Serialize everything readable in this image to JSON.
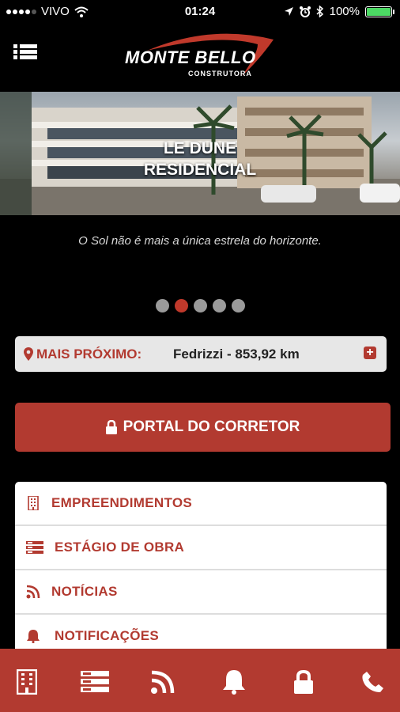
{
  "status_bar": {
    "carrier": "VIVO",
    "time": "01:24",
    "battery": "100%",
    "battery_level": 1.0
  },
  "header": {
    "logo_name": "MONTE BELLO",
    "logo_sub": "CONSTRUTORA"
  },
  "hero": {
    "title_line1": "LE DUNE",
    "title_line2": "RESIDENCIAL",
    "tagline": "O Sol não é mais a única estrela do horizonte.",
    "pager_count": 5,
    "pager_active_index": 1
  },
  "nearest": {
    "label": "MAIS PRÓXIMO:",
    "value": "Fedrizzi - 853,92 km"
  },
  "portal": {
    "label": "PORTAL DO CORRETOR"
  },
  "menu": {
    "items": [
      {
        "label": "EMPREENDIMENTOS",
        "icon": "building-icon"
      },
      {
        "label": "ESTÁGIO DE OBRA",
        "icon": "server-icon"
      },
      {
        "label": "NOTÍCIAS",
        "icon": "rss-icon"
      },
      {
        "label": "NOTIFICAÇÕES",
        "icon": "bell-icon"
      }
    ]
  },
  "tabbar": {
    "tabs": [
      "building-icon",
      "server-icon",
      "rss-icon",
      "bell-icon",
      "lock-icon",
      "phone-icon"
    ]
  },
  "colors": {
    "accent": "#b23a30",
    "background": "#000000",
    "nearest_bg": "#e7e7e7"
  }
}
